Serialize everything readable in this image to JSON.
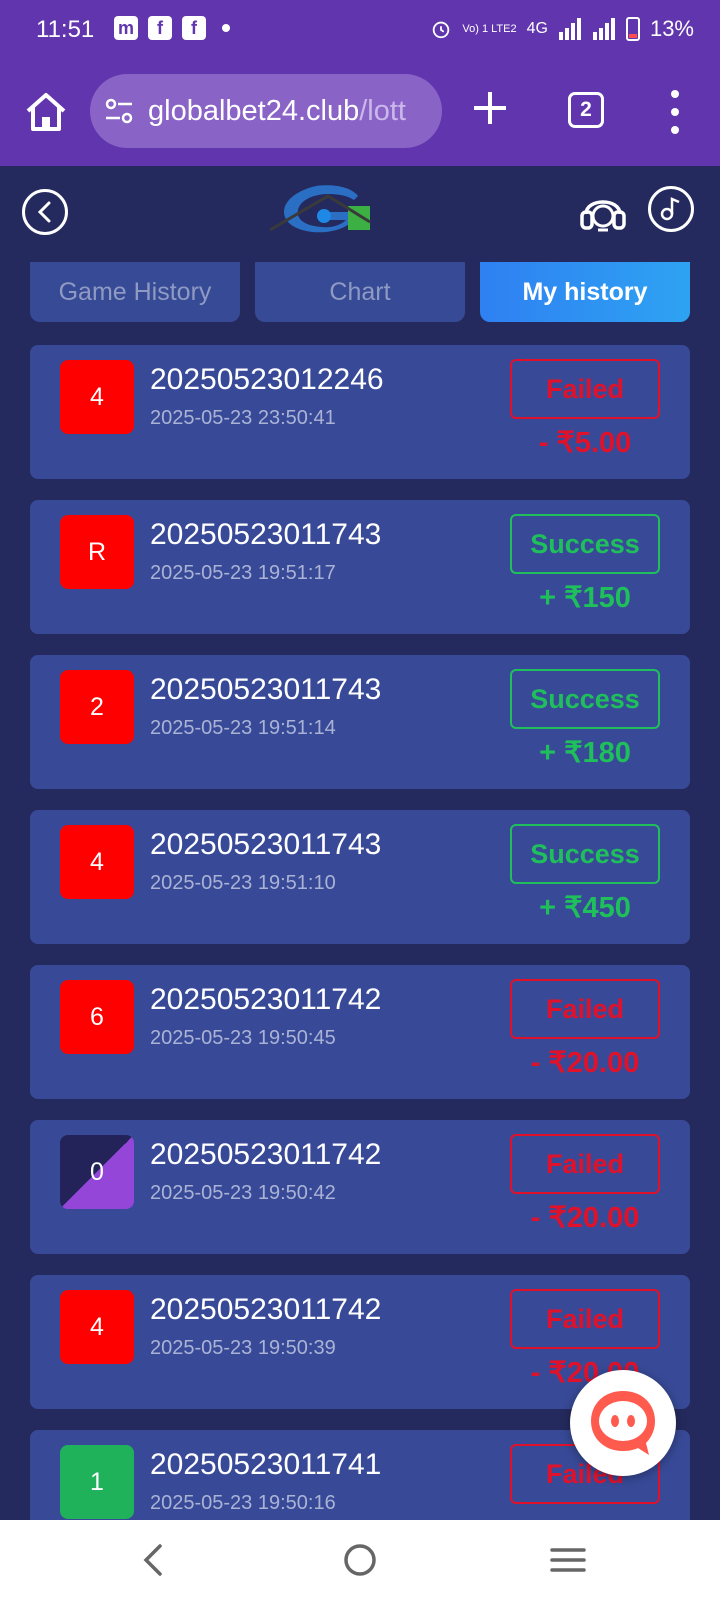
{
  "status_bar": {
    "time": "11:51",
    "network_label": "Vo) 1 LTE2",
    "network_type": "4G",
    "battery": "13%",
    "app_icons": [
      "messenger-icon",
      "facebook-icon",
      "facebook-icon"
    ]
  },
  "browser": {
    "url_domain": "globalbet24.club",
    "url_path": "/lott",
    "tab_count": "2"
  },
  "tabs": [
    {
      "label": "Game History",
      "active": false
    },
    {
      "label": "Chart",
      "active": false
    },
    {
      "label": "My history",
      "active": true
    }
  ],
  "history": [
    {
      "number": "4",
      "color": "red",
      "period": "20250523012246",
      "time": "2025-05-23 23:50:41",
      "status": "Failed",
      "amount": "- ₹5.00"
    },
    {
      "number": "R",
      "color": "red",
      "period": "20250523011743",
      "time": "2025-05-23 19:51:17",
      "status": "Success",
      "amount": "+ ₹150"
    },
    {
      "number": "2",
      "color": "red",
      "period": "20250523011743",
      "time": "2025-05-23 19:51:14",
      "status": "Success",
      "amount": "+ ₹180"
    },
    {
      "number": "4",
      "color": "red",
      "period": "20250523011743",
      "time": "2025-05-23 19:51:10",
      "status": "Success",
      "amount": "+ ₹450"
    },
    {
      "number": "6",
      "color": "red",
      "period": "20250523011742",
      "time": "2025-05-23 19:50:45",
      "status": "Failed",
      "amount": "- ₹20.00"
    },
    {
      "number": "0",
      "color": "violet",
      "period": "20250523011742",
      "time": "2025-05-23 19:50:42",
      "status": "Failed",
      "amount": "- ₹20.00"
    },
    {
      "number": "4",
      "color": "red",
      "period": "20250523011742",
      "time": "2025-05-23 19:50:39",
      "status": "Failed",
      "amount": "- ₹20.00"
    },
    {
      "number": "1",
      "color": "green",
      "period": "20250523011741",
      "time": "2025-05-23 19:50:16",
      "status": "Failed",
      "amount": ""
    }
  ],
  "colors": {
    "header": "#6135ad",
    "page_bg": "#252a5e",
    "card_bg": "#384a97",
    "failed": "#e0122b",
    "success": "#1fbf5c"
  }
}
